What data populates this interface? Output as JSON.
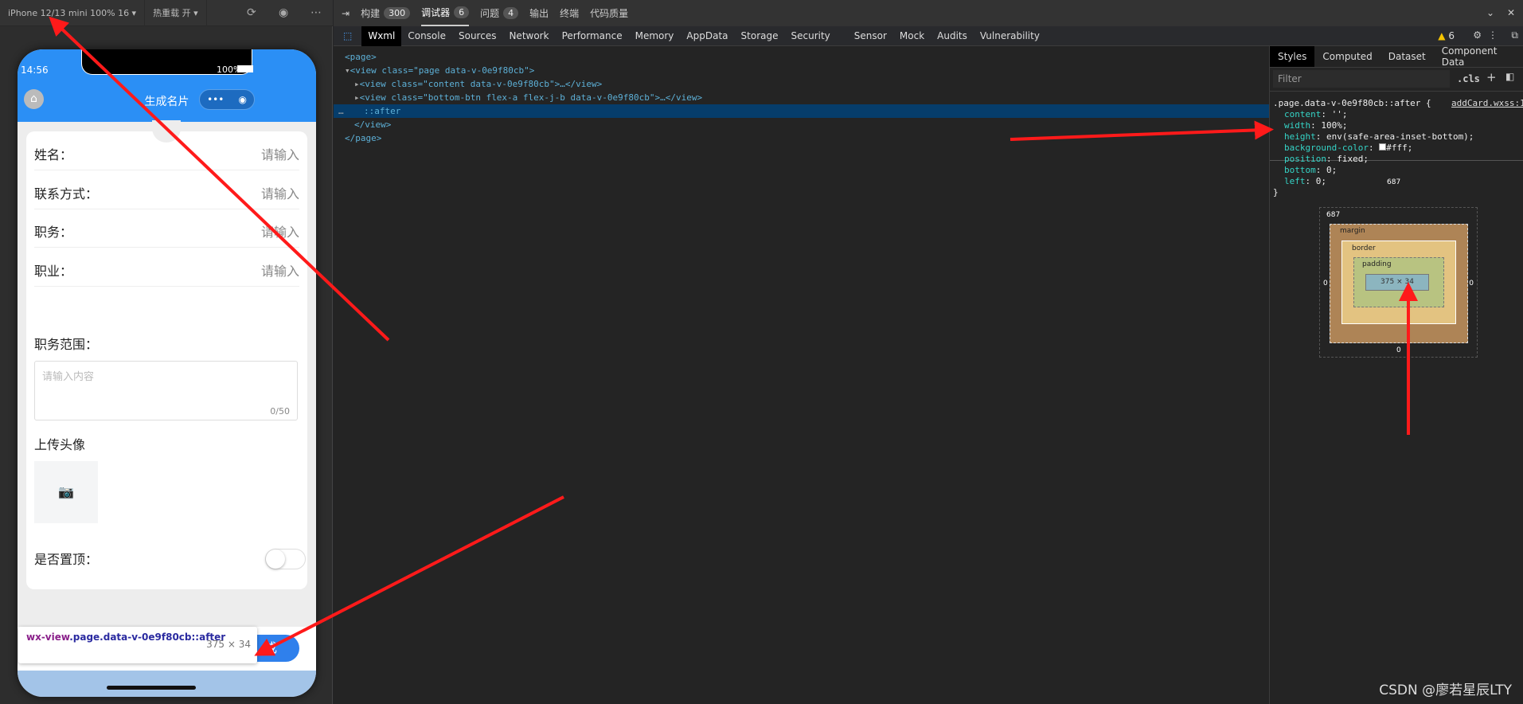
{
  "simulator": {
    "device": "iPhone 12/13 mini 100% 16 ▾",
    "hotreload": "热重载 开 ▾",
    "icons": [
      "refresh-icon",
      "stop-icon",
      "more-icon"
    ]
  },
  "phone": {
    "time": "14:56",
    "battery": "100%",
    "title": "生成名片",
    "fields": [
      {
        "label": "姓名：",
        "placeholder": "请输入"
      },
      {
        "label": "联系方式：",
        "placeholder": "请输入"
      },
      {
        "label": "职务：",
        "placeholder": "请输入"
      },
      {
        "label": "职业：",
        "placeholder": "请输入"
      }
    ],
    "scope_label": "职务范围：",
    "scope_placeholder": "请输入内容",
    "scope_count": "0/50",
    "upload_label": "上传头像",
    "top_label": "是否置顶：",
    "top_on": false,
    "bottom_btn": "成",
    "tooltip": {
      "selector_tag": "wx-view",
      "selector_rest": ".page.data-v-0e9f80cb::after",
      "size": "375 × 34"
    }
  },
  "devtools": {
    "top_tabs": [
      {
        "label": "构建",
        "badge": "300"
      },
      {
        "label": "调试器",
        "badge": "6"
      },
      {
        "label": "问题",
        "badge": "4"
      },
      {
        "label": "输出"
      },
      {
        "label": "终端"
      },
      {
        "label": "代码质量"
      }
    ],
    "tabs": [
      "Wxml",
      "Console",
      "Sources",
      "Network",
      "Performance",
      "Memory",
      "AppData",
      "Storage",
      "Security",
      "Sensor",
      "Mock",
      "Audits",
      "Vulnerability"
    ],
    "warnings": "6",
    "wxml": [
      "<page>",
      "<view class=\"page data-v-0e9f80cb\">",
      "<view class=\"content data-v-0e9f80cb\">…</view>",
      "<view class=\"bottom-btn flex-a flex-j-b data-v-0e9f80cb\">…</view>",
      "::after",
      "</view>",
      "</page>"
    ],
    "styles": {
      "tabs": [
        "Styles",
        "Computed",
        "Dataset",
        "Component Data"
      ],
      "filter_placeholder": "Filter",
      "cls": ".cls",
      "selector": ".page.data-v-0e9f80cb::after {",
      "source": "addCard.wxss:13",
      "props": [
        [
          "content",
          "'';"
        ],
        [
          "width",
          "100%;"
        ],
        [
          "height",
          "env(safe-area-inset-bottom);"
        ],
        [
          "background-color",
          "#fff;"
        ],
        [
          "position",
          "fixed;"
        ],
        [
          "bottom",
          "0;"
        ],
        [
          "left",
          "0;"
        ]
      ],
      "close": "}",
      "box": {
        "position": "687",
        "margin": "margin",
        "border": "border",
        "padding": "padding",
        "content": "375 × 34",
        "dash": "–",
        "zero": "0"
      }
    }
  },
  "watermark": "CSDN @廖若星辰LTY",
  "colors": {
    "nav": "#2b8ff5",
    "highlight": "#a3c4e8",
    "arrow": "#ff1a1a"
  }
}
